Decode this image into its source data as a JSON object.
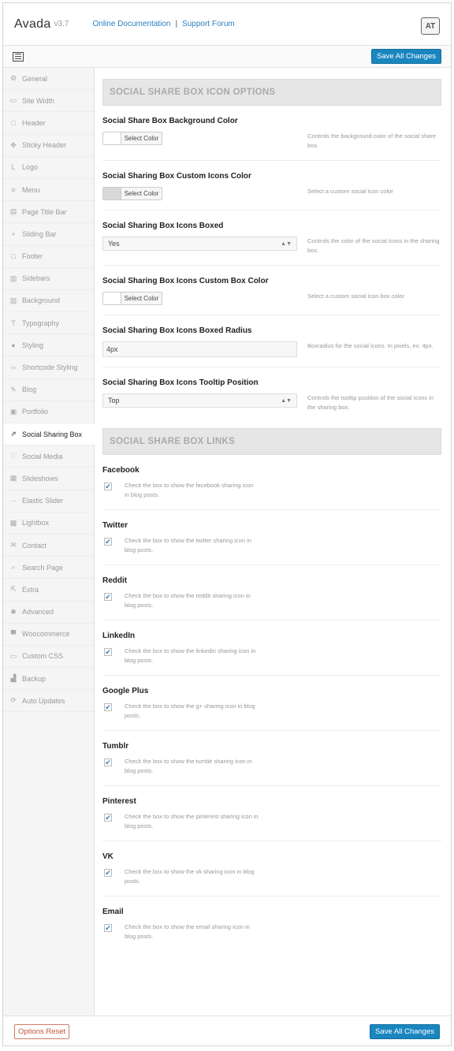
{
  "header": {
    "brand": "Avada",
    "version": "v3.7",
    "link_docs": "Online Documentation",
    "separator": "|",
    "link_forum": "Support Forum",
    "logo_text": "AT"
  },
  "toolbar": {
    "save_label": "Save All Changes"
  },
  "footer": {
    "reset_label": "Options Reset",
    "save_label": "Save All Changes"
  },
  "sidebar": {
    "items": [
      {
        "label": "General",
        "icon": "gear-icon",
        "glyph": "⚙"
      },
      {
        "label": "Site Width",
        "icon": "width-icon",
        "glyph": "▭"
      },
      {
        "label": "Header",
        "icon": "header-icon",
        "glyph": "□"
      },
      {
        "label": "Sticky Header",
        "icon": "pin-icon",
        "glyph": "✥"
      },
      {
        "label": "Logo",
        "icon": "logo-icon",
        "glyph": "L"
      },
      {
        "label": "Menu",
        "icon": "menu-icon",
        "glyph": "≡"
      },
      {
        "label": "Page Title Bar",
        "icon": "title-bar-icon",
        "glyph": "▤"
      },
      {
        "label": "Sliding Bar",
        "icon": "plus-icon",
        "glyph": "+"
      },
      {
        "label": "Footer",
        "icon": "footer-icon",
        "glyph": "□"
      },
      {
        "label": "Sidebars",
        "icon": "sidebars-icon",
        "glyph": "▥"
      },
      {
        "label": "Background",
        "icon": "image-icon",
        "glyph": "▨"
      },
      {
        "label": "Typography",
        "icon": "typography-icon",
        "glyph": "T"
      },
      {
        "label": "Styling",
        "icon": "drop-icon",
        "glyph": "●"
      },
      {
        "label": "Shortcode Styling",
        "icon": "code-icon",
        "glyph": "‹›"
      },
      {
        "label": "Blog",
        "icon": "pen-icon",
        "glyph": "✎"
      },
      {
        "label": "Portfolio",
        "icon": "portfolio-icon",
        "glyph": "▣"
      },
      {
        "label": "Social Sharing Box",
        "icon": "share-icon",
        "glyph": "⇗"
      },
      {
        "label": "Social Media",
        "icon": "heart-icon",
        "glyph": "♡"
      },
      {
        "label": "Slideshows",
        "icon": "slideshow-icon",
        "glyph": "▦"
      },
      {
        "label": "Elastic Slider",
        "icon": "slider-icon",
        "glyph": "⋯"
      },
      {
        "label": "Lightbox",
        "icon": "lightbox-icon",
        "glyph": "▩"
      },
      {
        "label": "Contact",
        "icon": "mail-icon",
        "glyph": "✉"
      },
      {
        "label": "Search Page",
        "icon": "search-icon",
        "glyph": "⌕"
      },
      {
        "label": "Extra",
        "icon": "external-icon",
        "glyph": "⇱"
      },
      {
        "label": "Advanced",
        "icon": "star-icon",
        "glyph": "✱"
      },
      {
        "label": "Woocommerce",
        "icon": "cart-icon",
        "glyph": "▀"
      },
      {
        "label": "Custom CSS",
        "icon": "css-icon",
        "glyph": "▭"
      },
      {
        "label": "Backup",
        "icon": "backup-icon",
        "glyph": "▟"
      },
      {
        "label": "Auto Updates",
        "icon": "refresh-icon",
        "glyph": "⟳"
      }
    ],
    "active_index": 16
  },
  "main": {
    "section1": "SOCIAL SHARE BOX ICON OPTIONS",
    "section2": "SOCIAL SHARE BOX LINKS",
    "color_button_label": "Select Color",
    "options": {
      "bg_color": {
        "title": "Social Share Box Background Color",
        "desc": "Controls the background color of the social share box.",
        "swatch": "#ffffff"
      },
      "icons_color": {
        "title": "Social Sharing Box Custom Icons Color",
        "desc": "Select a custom social icon color",
        "swatch": "#d9d9d9"
      },
      "icons_boxed": {
        "title": "Social Sharing Box Icons Boxed",
        "value": "Yes",
        "desc": "Controls the color of the social icons in the sharing box."
      },
      "box_color": {
        "title": "Social Sharing Box Icons Custom Box Color",
        "desc": "Select a custom social icon box color",
        "swatch": "#ffffff"
      },
      "boxed_radius": {
        "title": "Social Sharing Box Icons Boxed Radius",
        "value": "4px",
        "desc": "Boxradius for the social icons. In pixels, ex: 4px."
      },
      "tooltip": {
        "title": "Social Sharing Box Icons Tooltip Position",
        "value": "Top",
        "desc": "Controls the tooltip position of the social icons in the sharing box."
      }
    },
    "links": [
      {
        "title": "Facebook",
        "desc": "Check the box to show the facebook sharing icon in blog posts."
      },
      {
        "title": "Twitter",
        "desc": "Check the box to show the twitter sharing icon in blog posts."
      },
      {
        "title": "Reddit",
        "desc": "Check the box to show the reddit sharing icon in blog posts."
      },
      {
        "title": "LinkedIn",
        "desc": "Check the box to show the linkedin sharing icon in blog posts."
      },
      {
        "title": "Google Plus",
        "desc": "Check the box to show the g+ sharing icon in blog posts."
      },
      {
        "title": "Tumblr",
        "desc": "Check the box to show the tumblr sharing icon in blog posts."
      },
      {
        "title": "Pinterest",
        "desc": "Check the box to show the pinterest sharing icon in blog posts."
      },
      {
        "title": "VK",
        "desc": "Check the box to show the vk sharing icon in blog posts."
      },
      {
        "title": "Email",
        "desc": "Check the box to show the email sharing icon in blog posts."
      }
    ],
    "check_mark": "✔"
  }
}
